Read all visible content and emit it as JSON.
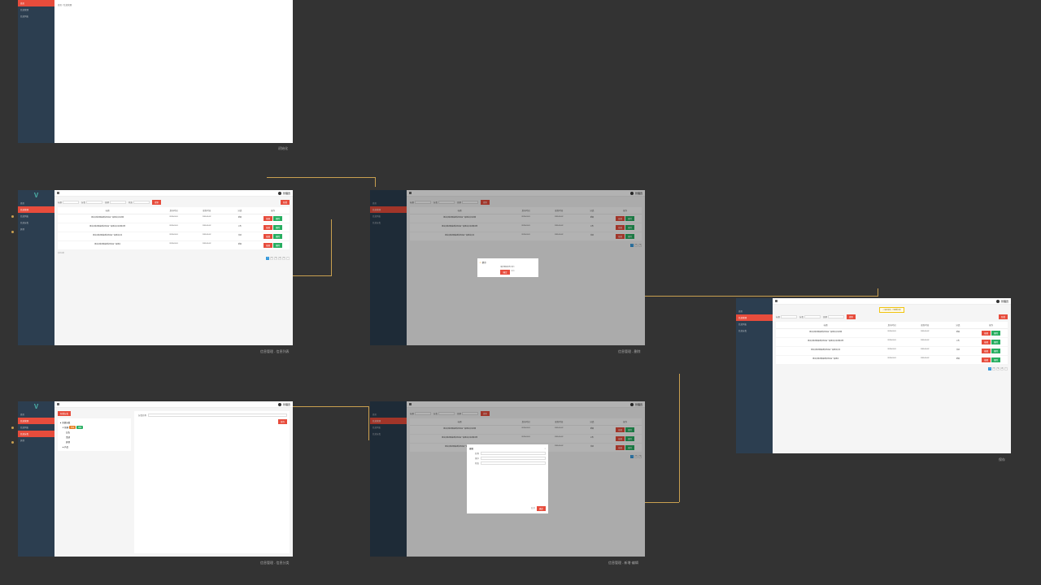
{
  "sidebar": {
    "logo": "V",
    "items": [
      {
        "label": "首页"
      },
      {
        "label": "信息管理"
      },
      {
        "label": "信息列表"
      },
      {
        "label": "信息分类"
      },
      {
        "label": "其他"
      }
    ]
  },
  "topbar": {
    "user": "管理员"
  },
  "screen1": {
    "breadcrumb": "首页 / 信息管理"
  },
  "screen2": {
    "caption": "信息管理 - 信息列表",
    "filters": {
      "title": "标题",
      "category": "分类",
      "date": "日期",
      "status": "状态",
      "search_btn": "搜索",
      "add_btn": "新增"
    },
    "table": {
      "headers": [
        "标题",
        "发布时间",
        "更新时间",
        "分类",
        "操作"
      ],
      "rows": [
        {
          "title": "测试文章内容描述信息这是一段测试文本内容",
          "created": "2019-01-01",
          "updated": "2019-01-02",
          "cat": "新闻"
        },
        {
          "title": "测试文章内容描述信息这是一段测试文本内容示例",
          "created": "2019-01-01",
          "updated": "2019-01-02",
          "cat": "公告"
        },
        {
          "title": "测试文章内容描述信息这是一段测试文本",
          "created": "2019-01-01",
          "updated": "2019-01-02",
          "cat": "活动"
        },
        {
          "title": "测试文章内容描述信息这是一段测试",
          "created": "2019-01-01",
          "updated": "2019-01-02",
          "cat": "新闻"
        }
      ],
      "actions": {
        "edit": "编辑",
        "delete": "删除"
      }
    },
    "footer_text": "信息总数"
  },
  "screen3": {
    "caption": "信息管理 - 删除",
    "modal": {
      "icon": "⚠",
      "title": "提示",
      "body": "确定删除此条记录?",
      "confirm": "确定",
      "cancel": "取消"
    }
  },
  "screen4": {
    "caption": "信息管理 - 信息分类",
    "add_btn": "新增分类",
    "tree": [
      {
        "label": "全部分类"
      },
      {
        "label": "新闻",
        "tags": [
          "修改",
          "删除"
        ]
      },
      {
        "label": "公告"
      },
      {
        "label": "活动"
      },
      {
        "label": "其他"
      },
      {
        "label": "产品"
      }
    ],
    "form": {
      "name_label": "分类名称",
      "save_btn": "保存"
    }
  },
  "screen5": {
    "caption": "信息管理 - 新增·编辑",
    "modal": {
      "title": "编辑",
      "fields": {
        "name": "名称",
        "sort": "排序",
        "status": "状态"
      },
      "confirm": "确定",
      "cancel": "取消"
    }
  },
  "screen6": {
    "caption": "保存",
    "toast": "✓ 保存成功，已更新记录"
  },
  "captions": {
    "screen1": "初始化"
  }
}
